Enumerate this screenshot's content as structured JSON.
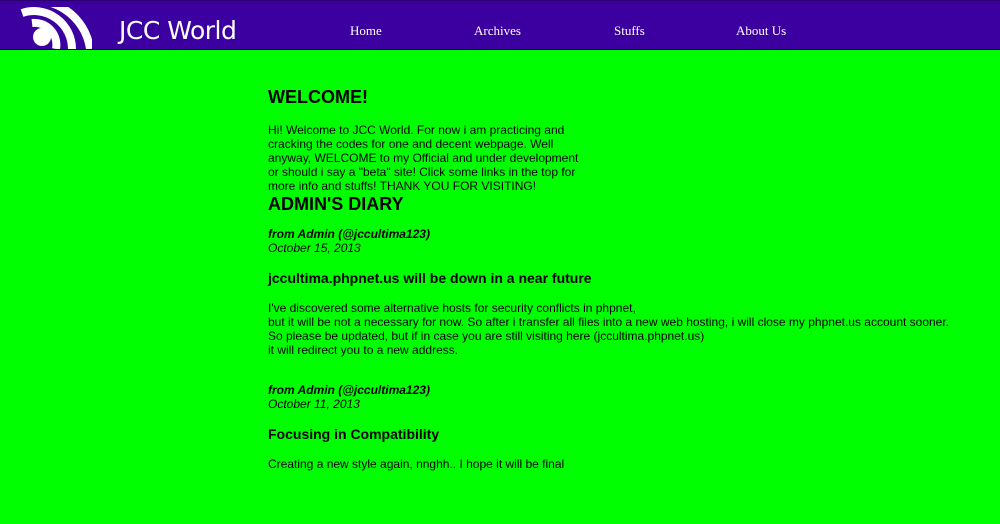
{
  "header": {
    "logo_text": "JCC World",
    "nav": [
      {
        "label": "Home"
      },
      {
        "label": "Archives"
      },
      {
        "label": "Stuffs"
      },
      {
        "label": "About Us"
      }
    ]
  },
  "colors": {
    "background": "#00ff00",
    "header_bg": "#3d00a0",
    "text": "#000000",
    "nav_text": "#ffffff"
  },
  "welcome": {
    "heading": "WELCOME!",
    "text": "Hi! Welcome to JCC World. For now i am practicing and cracking the codes for one and decent webpage. Well anyway, WELCOME to my Official and under development or should i say a \"beta\" site! Click some links in the top for more info and stuffs! THANK YOU FOR VISITING!"
  },
  "diary": {
    "heading": "ADMIN'S DIARY",
    "entries": [
      {
        "from": "from Admin (@jccultima123)",
        "date": "October 15, 2013",
        "title": "jccultima.phpnet.us will be down in a near future",
        "lines": [
          "I've discovered some alternative hosts for security conflicts in phpnet,",
          "but it will be not a necessary for now. So after i transfer all files into a new web hosting, i will close my phpnet.us account sooner.",
          "So please be updated, but if in case you are still visiting here (jccultima.phpnet.us)",
          "it will redirect you to a new address."
        ]
      },
      {
        "from": "from Admin (@jccultima123)",
        "date": "October 11, 2013",
        "title": "Focusing in Compatibility",
        "lines": [
          "Creating a new style again, nnghh.. I hope it will be final"
        ]
      }
    ]
  }
}
